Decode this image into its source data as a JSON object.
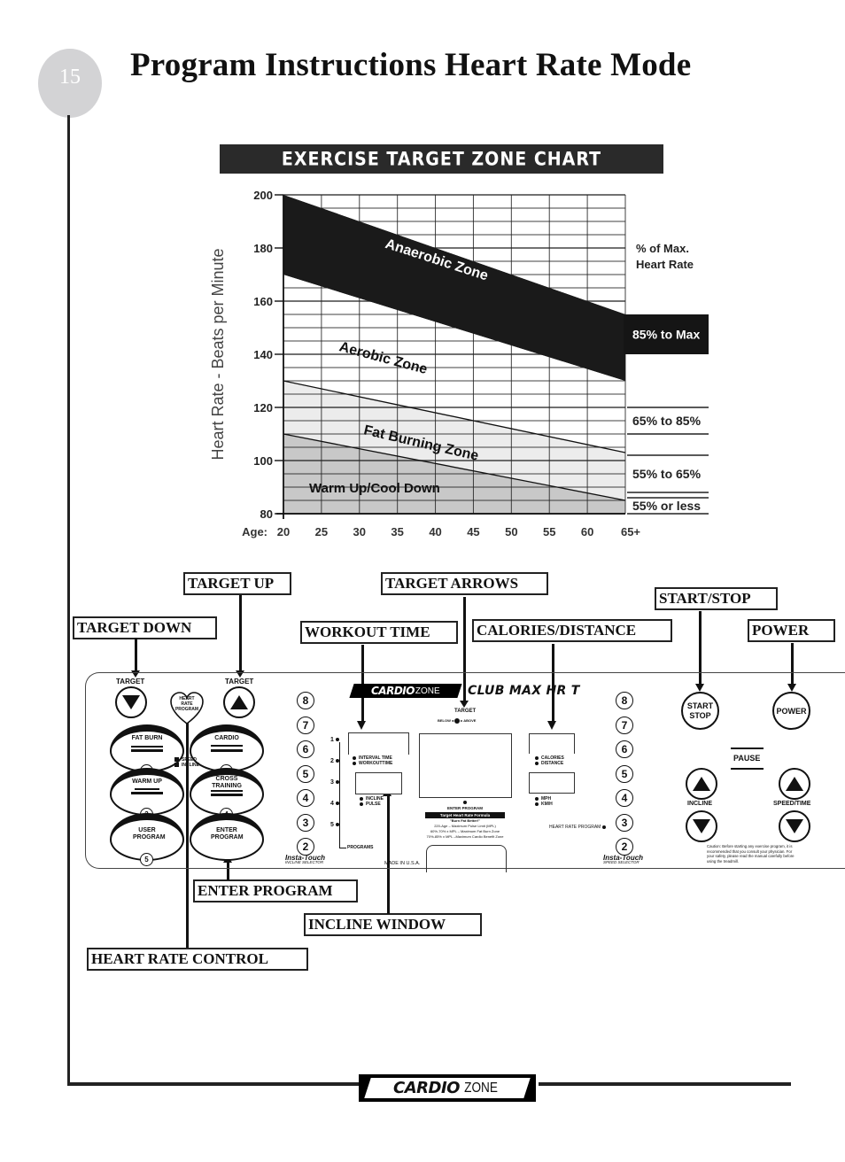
{
  "page": {
    "number": "15",
    "title": "Program Instructions Heart Rate Mode"
  },
  "chart_data": {
    "type": "area",
    "title": "EXERCISE TARGET ZONE CHART",
    "xlabel": "Age:",
    "ylabel": "Heart Rate - Beats per Minute",
    "x": [
      20,
      65
    ],
    "x_ticks": [
      "20",
      "25",
      "30",
      "35",
      "40",
      "45",
      "50",
      "55",
      "60",
      "65+"
    ],
    "x_tick_values": [
      20,
      25,
      30,
      35,
      40,
      45,
      50,
      55,
      60,
      65
    ],
    "y_ticks": [
      "80",
      "100",
      "120",
      "140",
      "160",
      "180",
      "200"
    ],
    "y_tick_values": [
      80,
      100,
      120,
      140,
      160,
      180,
      200
    ],
    "ylim": [
      80,
      200
    ],
    "xlim": [
      20,
      65
    ],
    "grid": true,
    "series": [
      {
        "name": "Anaerobic Zone",
        "lower": [
          170,
          130
        ],
        "upper": [
          200,
          155
        ],
        "fill": "#1a1a1a",
        "label_color": "#ffffff"
      },
      {
        "name": "Aerobic Zone",
        "lower": [
          130,
          103
        ],
        "upper": [
          170,
          130
        ],
        "fill": "#ffffff",
        "label_color": "#111111"
      },
      {
        "name": "Fat Burning Zone",
        "lower": [
          110,
          85
        ],
        "upper": [
          130,
          103
        ],
        "fill": "#ececec",
        "label_color": "#111111"
      },
      {
        "name": "Warm Up/Cool Down",
        "lower": [
          80,
          80
        ],
        "upper": [
          110,
          85
        ],
        "fill": "#c8c8c8",
        "label_color": "#111111"
      }
    ],
    "legend": {
      "title": "% of Max. Heart Rate",
      "placement": "right",
      "entries": [
        {
          "label": "85% to Max",
          "dark": true
        },
        {
          "label": "65% to 85%",
          "dark": false
        },
        {
          "label": "55% to 65%",
          "dark": false
        },
        {
          "label": "55% or less",
          "dark": false
        }
      ]
    }
  },
  "callouts": {
    "target_up": "TARGET UP",
    "target_arrows": "TARGET ARROWS",
    "start_stop": "START/STOP",
    "target_down": "TARGET DOWN",
    "workout_time": "WORKOUT TIME",
    "calories_distance": "CALORIES/DISTANCE",
    "power": "POWER",
    "enter_program": "ENTER PROGRAM",
    "incline_window": "INCLINE WINDOW",
    "heart_rate_control": "HEART RATE CONTROL"
  },
  "panel": {
    "target_label": "TARGET",
    "heart_label": "HEART RATE PROGRAM",
    "programs": [
      {
        "label": "FAT BURN",
        "num": "1"
      },
      {
        "label": "CARDIO",
        "num": "2"
      },
      {
        "label": "WARM UP",
        "num": "3"
      },
      {
        "label": "CROSS TRAINING",
        "num": "4"
      },
      {
        "label": "USER PROGRAM",
        "num": "5"
      },
      {
        "label": "ENTER PROGRAM",
        "num": ""
      }
    ],
    "legend_speed": "SPEED",
    "legend_incline": "INCLINE",
    "incline_selector": [
      "8",
      "7",
      "6",
      "5",
      "4",
      "3",
      "2"
    ],
    "speed_selector": [
      "8",
      "7",
      "6",
      "5",
      "4",
      "3",
      "2"
    ],
    "program_dots": [
      "1",
      "2",
      "3",
      "4",
      "5"
    ],
    "programs_label": "PROGRAMS",
    "insta_touch": "Insta-Touch",
    "incline_selector_label": "INCLINE SELECTOR",
    "speed_selector_label": "SPEED SELECTOR",
    "brand_cardio": "CARDIO",
    "brand_zone": "ZONE",
    "model": "CLUB MAX HR T",
    "target_center": "TARGET",
    "below": "BELOW",
    "above": "ABOVE",
    "interval_time": "INTERVAL TIME",
    "workout_time": "WORKOUTTIME",
    "incline": "INCLINE",
    "pulse": "PULSE",
    "calories": "CALORIES",
    "distance": "DISTANCE",
    "mph": "MPH",
    "kmh": "KM/H",
    "enter_program": "ENTER PROGRAM",
    "formula_title": "Target Heart Rate Formula",
    "formula_sub": "\"Burn Fat Better!\"",
    "formula_1": "220-Age – Maximum Pulse Limit (MPL)",
    "formula_2": "60%-70% x MPL – Maximum Fat Burn Zone",
    "formula_3": "70%-85% x MPL –Maximum Cardio Benefit Zone",
    "heart_rate_program": "HEART RATE PROGRAM",
    "made_in": "MADE IN U.S.A.",
    "start": "START",
    "stop": "STOP",
    "power": "POWER",
    "pause": "PAUSE",
    "incline_btn": "INCLINE",
    "speed_time": "SPEED/TIME",
    "caution": "Caution: Before starting any exercise program, it is recommended that you consult your physician. For your safety, please read the manual carefully before using the treadmill."
  },
  "footer": {
    "brand_cardio": "CARDIO",
    "brand_zone": "ZONE"
  }
}
